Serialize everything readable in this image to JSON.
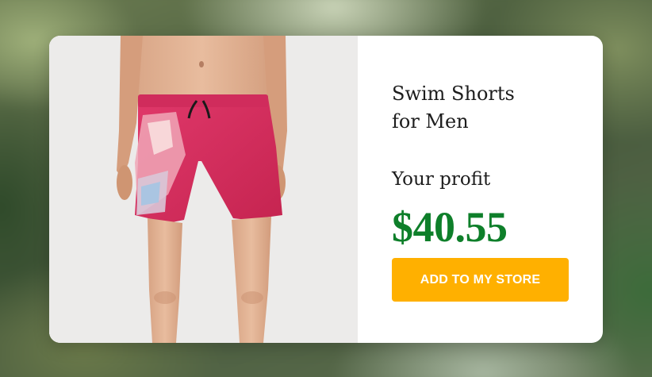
{
  "product": {
    "title_line1": "Swim Shorts",
    "title_line2": "for Men",
    "profit_label": "Your profit",
    "price": "$40.55",
    "cta_label": "ADD TO MY STORE"
  },
  "colors": {
    "price": "#0e7f2a",
    "cta_background": "#ffb000",
    "shorts": "#d62e5a"
  },
  "image": {
    "subject": "model-wearing-red-swim-shorts"
  }
}
